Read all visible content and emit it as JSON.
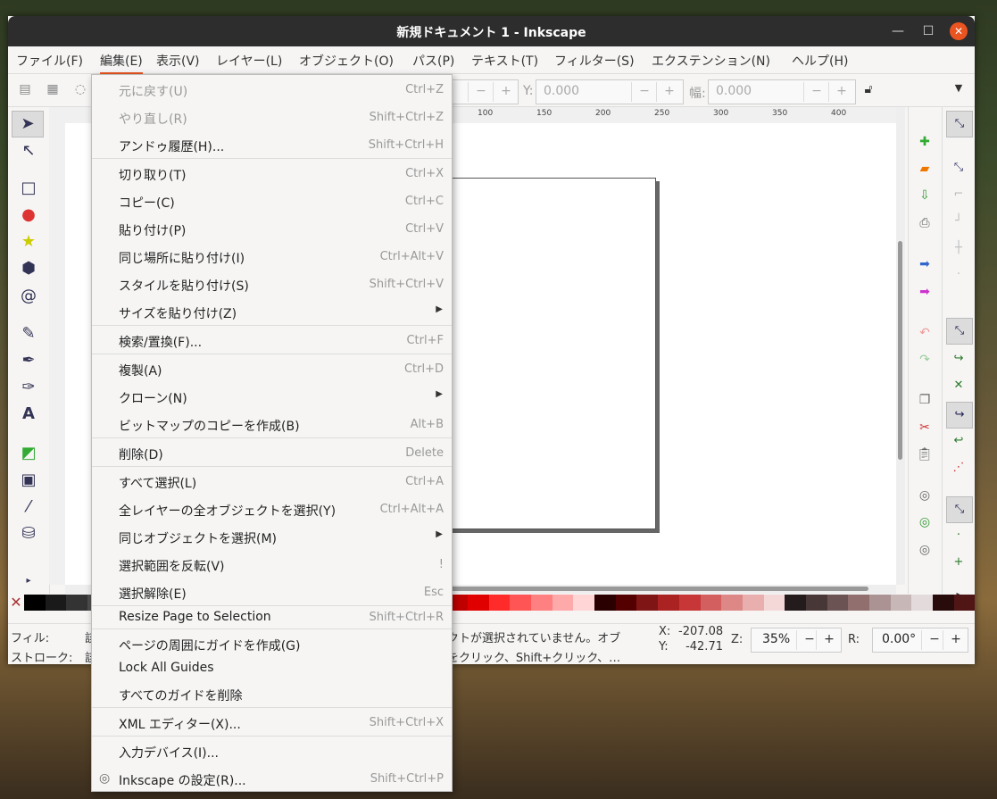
{
  "window": {
    "title": "新規ドキュメント 1 - Inkscape"
  },
  "menubar": [
    {
      "label": "ファイル(F)"
    },
    {
      "label": "編集(E)"
    },
    {
      "label": "表示(V)"
    },
    {
      "label": "レイヤー(L)"
    },
    {
      "label": "オブジェクト(O)"
    },
    {
      "label": "パス(P)"
    },
    {
      "label": "テキスト(T)"
    },
    {
      "label": "フィルター(S)"
    },
    {
      "label": "エクステンション(N)"
    },
    {
      "label": "ヘルプ(H)"
    }
  ],
  "toolbar": {
    "y_label": "Y:",
    "y_value": "0.000",
    "w_label": "幅:",
    "w_value": "0.000"
  },
  "ruler_ticks": [
    "100",
    "150",
    "200",
    "250",
    "300",
    "350",
    "400"
  ],
  "edit_menu": [
    {
      "label": "元に戻す(U)",
      "shortcut": "Ctrl+Z",
      "disabled": true
    },
    {
      "label": "やり直し(R)",
      "shortcut": "Shift+Ctrl+Z",
      "disabled": true
    },
    {
      "label": "アンドゥ履歴(H)...",
      "shortcut": "Shift+Ctrl+H"
    },
    {
      "label": "切り取り(T)",
      "shortcut": "Ctrl+X"
    },
    {
      "label": "コピー(C)",
      "shortcut": "Ctrl+C"
    },
    {
      "label": "貼り付け(P)",
      "shortcut": "Ctrl+V"
    },
    {
      "label": "同じ場所に貼り付け(I)",
      "shortcut": "Ctrl+Alt+V"
    },
    {
      "label": "スタイルを貼り付け(S)",
      "shortcut": "Shift+Ctrl+V"
    },
    {
      "label": "サイズを貼り付け(Z)",
      "shortcut": ""
    },
    {
      "label": "検索/置換(F)...",
      "shortcut": "Ctrl+F"
    },
    {
      "label": "複製(A)",
      "shortcut": "Ctrl+D"
    },
    {
      "label": "クローン(N)",
      "shortcut": ""
    },
    {
      "label": "ビットマップのコピーを作成(B)",
      "shortcut": "Alt+B"
    },
    {
      "label": "削除(D)",
      "shortcut": "Delete"
    },
    {
      "label": "すべて選択(L)",
      "shortcut": "Ctrl+A"
    },
    {
      "label": "全レイヤーの全オブジェクトを選択(Y)",
      "shortcut": "Ctrl+Alt+A"
    },
    {
      "label": "同じオブジェクトを選択(M)",
      "shortcut": ""
    },
    {
      "label": "選択範囲を反転(V)",
      "shortcut": "!"
    },
    {
      "label": "選択解除(E)",
      "shortcut": "Esc"
    },
    {
      "label": "Resize Page to Selection",
      "shortcut": "Shift+Ctrl+R"
    },
    {
      "label": "ページの周囲にガイドを作成(G)",
      "shortcut": ""
    },
    {
      "label": "Lock All Guides",
      "shortcut": ""
    },
    {
      "label": "すべてのガイドを削除",
      "shortcut": ""
    },
    {
      "label": "XML エディター(X)...",
      "shortcut": "Shift+Ctrl+X"
    },
    {
      "label": "入力デバイス(I)...",
      "shortcut": ""
    },
    {
      "label": "Inkscape の設定(R)...",
      "shortcut": "Shift+Ctrl+P"
    }
  ],
  "status": {
    "fill_label": "フィル:",
    "fill_value": "該",
    "stroke_label": "ストローク:",
    "stroke_value": "該",
    "message_line1": "クトが選択されていません。オブ",
    "message_line2": "をクリック、Shift+クリック、…",
    "x_label": "X:",
    "x_value": "-207.08",
    "y_label": "Y:",
    "y_value": "-42.71",
    "zoom_label": "Z:",
    "zoom_value": "35%",
    "rotate_label": "R:",
    "rotate_value": "0.00°"
  },
  "palette": [
    "#000000",
    "#1a1a1a",
    "#333333",
    "#4d4d4d",
    "#666666",
    "#808080",
    "#999999",
    "#b3b3b3",
    "#cccccc",
    "#e6e6e6",
    "#ffffff",
    "#800000",
    "#a00000",
    "#c00000",
    "#ff0000",
    "#ff00ff",
    "#400000",
    "#600000",
    "#800000",
    "#a00000",
    "#c00000",
    "#e00000",
    "#ff2a2a",
    "#ff5555",
    "#ff8080",
    "#ffaaaa",
    "#ffd5d5",
    "#2b0000",
    "#550000",
    "#801515",
    "#aa2222",
    "#c83737",
    "#d35f5f",
    "#de8787",
    "#e9afaf",
    "#f4d7d7",
    "#241c1c",
    "#483737",
    "#6c5353",
    "#916f6f",
    "#ac9393",
    "#c8b7b7",
    "#e3dbdb",
    "#280b0b",
    "#501616"
  ]
}
